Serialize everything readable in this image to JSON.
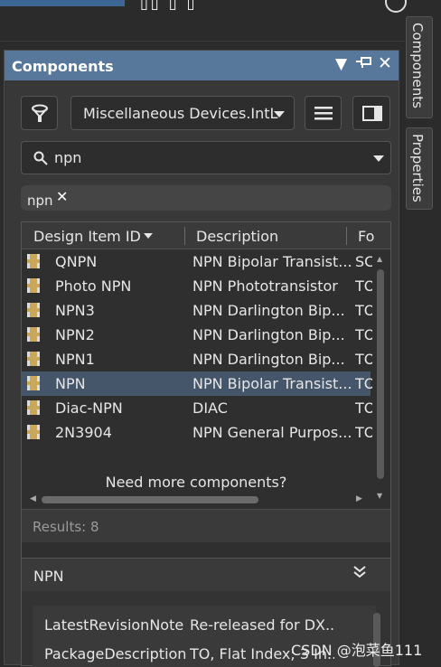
{
  "panel": {
    "title": "Components",
    "title_controls": [
      "menu-icon",
      "pin-icon",
      "close-icon"
    ]
  },
  "toolbar": {
    "library_selected": "Miscellaneous Devices.IntL"
  },
  "search": {
    "value": "npn"
  },
  "filter": {
    "tag": "npn"
  },
  "table": {
    "headers": [
      "Design Item ID",
      "Description",
      "Fo"
    ],
    "rows": [
      {
        "id": "QNPN",
        "desc": "NPN Bipolar Transist...",
        "fp": "SC",
        "selected": false
      },
      {
        "id": "Photo NPN",
        "desc": "NPN Phototransistor",
        "fp": "TO",
        "selected": false
      },
      {
        "id": "NPN3",
        "desc": "NPN Darlington Bip...",
        "fp": "TO",
        "selected": false
      },
      {
        "id": "NPN2",
        "desc": "NPN Darlington Bip...",
        "fp": "TO",
        "selected": false
      },
      {
        "id": "NPN1",
        "desc": "NPN Darlington Bip...",
        "fp": "TO",
        "selected": false
      },
      {
        "id": "NPN",
        "desc": "NPN Bipolar Transist...",
        "fp": "TO",
        "selected": true
      },
      {
        "id": "Diac-NPN",
        "desc": "DIAC",
        "fp": "TO",
        "selected": false
      },
      {
        "id": "2N3904",
        "desc": "NPN General Purpos...",
        "fp": "TO",
        "selected": false
      }
    ],
    "more_text": "Need more components?",
    "results": "Results: 8"
  },
  "details": {
    "name": "NPN",
    "props": [
      {
        "key": "LatestRevisionNote",
        "value": "Re-released for DX..."
      },
      {
        "key": "PackageDescription",
        "value": "TO, Flat Index; 3 In..."
      }
    ]
  },
  "side_tabs": [
    "Components",
    "Properties"
  ],
  "watermark": "CSDN @泡菜鱼111",
  "colors": {
    "title_bar": "#58789b",
    "selected_row": "#45566b",
    "chip": "#c9a85b"
  }
}
